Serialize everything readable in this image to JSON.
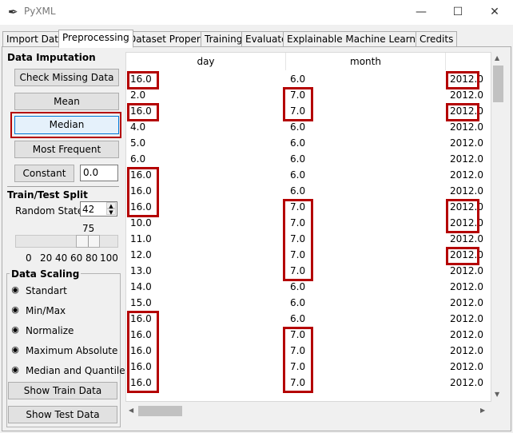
{
  "window": {
    "title": "PyXML",
    "minimize": "—",
    "maximize": "☐",
    "close": "✕"
  },
  "tabs": [
    "Import Data",
    "Preprocessing",
    "Dataset Property",
    "Training",
    "Evaluate",
    "Explainable Machine Learning",
    "Credits"
  ],
  "imputation": {
    "header": "Data Imputation",
    "check_missing": "Check Missing Data",
    "mean": "Mean",
    "median": "Median",
    "most_frequent": "Most Frequent",
    "constant": "Constant",
    "constant_value": "0.0"
  },
  "split": {
    "header": "Train/Test Split",
    "random_state_label": "Random State:",
    "random_state_value": "42",
    "slider_value": "75",
    "slider_ticks": [
      "0",
      "20",
      "40",
      "60",
      "80",
      "100"
    ]
  },
  "scaling": {
    "header": "Data Scaling",
    "options": [
      "Standart",
      "Min/Max",
      "Normalize",
      "Maximum Absolute",
      "Median and Quantile"
    ],
    "show_train": "Show Train Data",
    "show_test": "Show Test Data"
  },
  "table": {
    "columns": [
      "day",
      "month",
      ""
    ],
    "rows": [
      [
        "16.0",
        "6.0",
        "2012.0"
      ],
      [
        "2.0",
        "7.0",
        "2012.0"
      ],
      [
        "16.0",
        "7.0",
        "2012.0"
      ],
      [
        "4.0",
        "6.0",
        "2012.0"
      ],
      [
        "5.0",
        "6.0",
        "2012.0"
      ],
      [
        "6.0",
        "6.0",
        "2012.0"
      ],
      [
        "16.0",
        "6.0",
        "2012.0"
      ],
      [
        "16.0",
        "6.0",
        "2012.0"
      ],
      [
        "16.0",
        "7.0",
        "2012.0"
      ],
      [
        "10.0",
        "7.0",
        "2012.0"
      ],
      [
        "11.0",
        "7.0",
        "2012.0"
      ],
      [
        "12.0",
        "7.0",
        "2012.0"
      ],
      [
        "13.0",
        "7.0",
        "2012.0"
      ],
      [
        "14.0",
        "6.0",
        "2012.0"
      ],
      [
        "15.0",
        "6.0",
        "2012.0"
      ],
      [
        "16.0",
        "6.0",
        "2012.0"
      ],
      [
        "16.0",
        "7.0",
        "2012.0"
      ],
      [
        "16.0",
        "7.0",
        "2012.0"
      ],
      [
        "16.0",
        "7.0",
        "2012.0"
      ],
      [
        "16.0",
        "7.0",
        "2012.0"
      ]
    ]
  },
  "colors": {
    "highlight": "#b40000",
    "selected_button": "#e5f1fb",
    "selected_border": "#0078d7"
  }
}
